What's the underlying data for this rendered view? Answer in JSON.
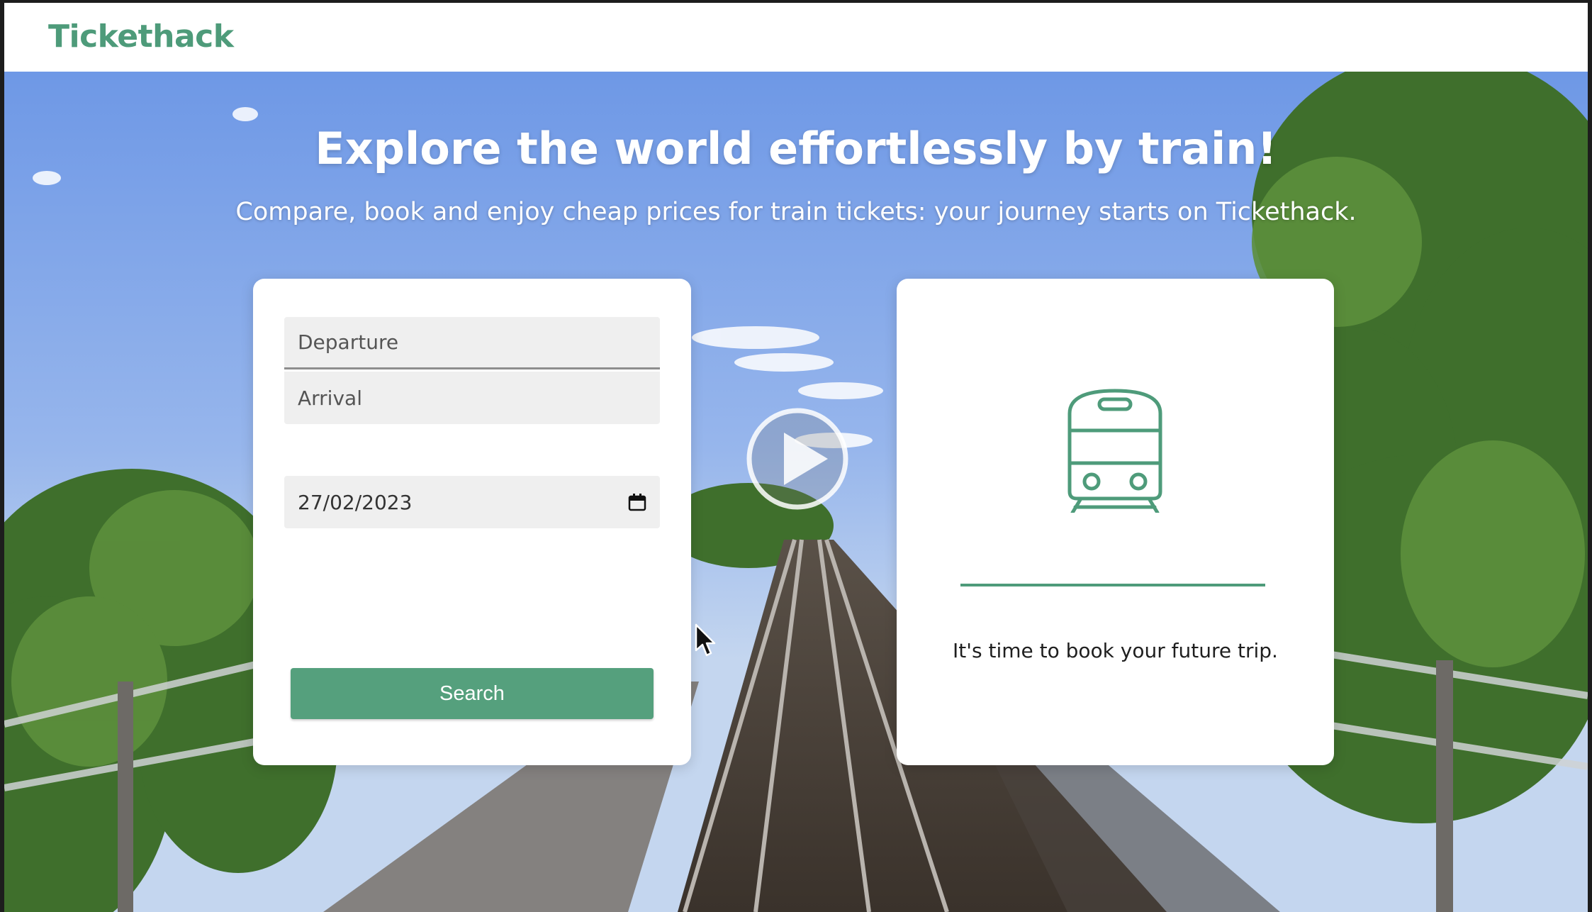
{
  "header": {
    "brand": "Tickethack"
  },
  "hero": {
    "title": "Explore the world effortlessly by train!",
    "subtitle": "Compare, book and enjoy cheap prices for train tickets: your journey starts on Tickethack."
  },
  "search_form": {
    "departure_placeholder": "Departure",
    "arrival_placeholder": "Arrival",
    "date_value": "27/02/2023",
    "date_icon": "calendar-icon",
    "search_label": "Search"
  },
  "result": {
    "icon": "train-icon",
    "message": "It's time to book your future trip."
  },
  "overlay": {
    "icons": [
      "play-icon",
      "cursor-icon"
    ]
  },
  "colors": {
    "brand": "#4e9b7a",
    "button": "#55a07d",
    "field_bg": "#efefef",
    "card_bg": "#ffffff"
  }
}
